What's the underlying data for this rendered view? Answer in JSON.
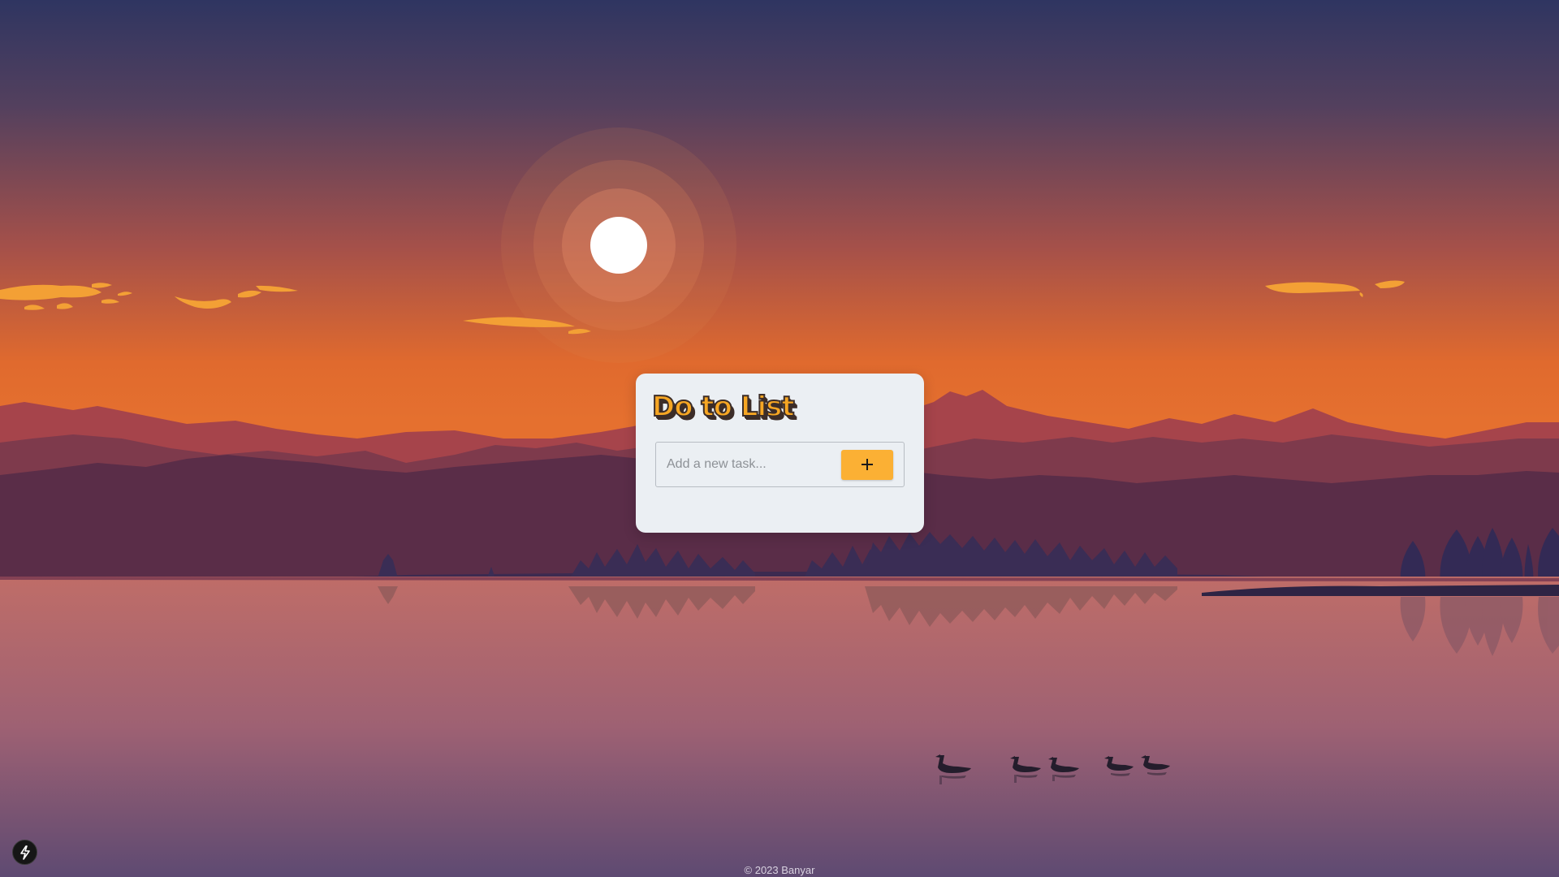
{
  "card": {
    "title": "Do to List",
    "input_placeholder": "Add a new task...",
    "input_value": "",
    "add_button_icon": "plus-icon"
  },
  "footer": {
    "text": "© 2023 Banyar"
  },
  "dev_badge": {
    "icon": "lightning-icon"
  },
  "colors": {
    "accent": "#fbb034",
    "card_background": "#ebeff3",
    "sky_top": "#2f3561",
    "sky_horizon": "#e5702f",
    "water": "#b8676a"
  }
}
